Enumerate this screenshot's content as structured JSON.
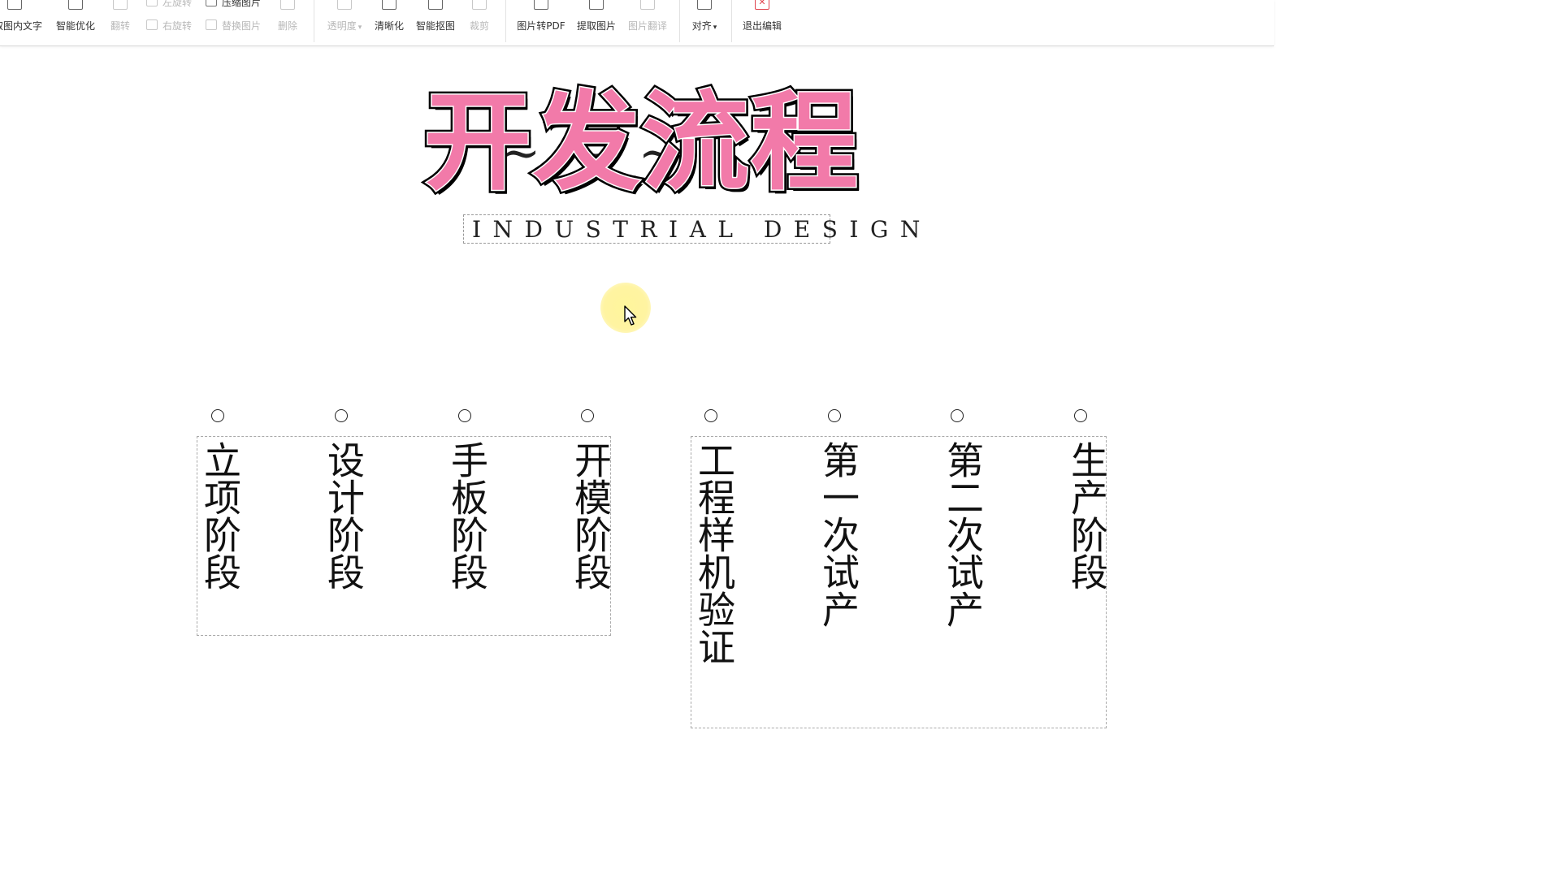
{
  "toolbar": {
    "buttons": [
      {
        "label": "提取图内文字",
        "state": "enabled"
      },
      {
        "label": "智能优化",
        "state": "enabled"
      },
      {
        "label": "翻转",
        "state": "disabled"
      },
      {
        "label": "左旋转",
        "state": "disabled"
      },
      {
        "label": "右旋转",
        "state": "disabled"
      },
      {
        "label": "压缩图片",
        "state": "enabled"
      },
      {
        "label": "替换图片",
        "state": "disabled"
      },
      {
        "label": "删除",
        "state": "disabled"
      },
      {
        "label": "透明度",
        "state": "disabled"
      },
      {
        "label": "清晰化",
        "state": "enabled"
      },
      {
        "label": "智能抠图",
        "state": "enabled"
      },
      {
        "label": "裁剪",
        "state": "disabled"
      },
      {
        "label": "图片转PDF",
        "state": "enabled"
      },
      {
        "label": "提取图片",
        "state": "enabled"
      },
      {
        "label": "图片翻译",
        "state": "disabled"
      },
      {
        "label": "对齐",
        "state": "enabled"
      },
      {
        "label": "退出编辑",
        "state": "enabled"
      }
    ],
    "accent_red": "#e0444f"
  },
  "slide": {
    "title": "开发流程",
    "title_color": "#f27aa9",
    "subtitle": "INDUSTRIAL DESIGN",
    "stages_group1": [
      "立项阶段",
      "设计阶段",
      "手板阶段",
      "开模阶段"
    ],
    "stages_group2": [
      "工程样机验证",
      "第一次试产",
      "第二次试产",
      "生产阶段"
    ]
  },
  "cursor": {
    "highlight_color": "#fff296"
  }
}
